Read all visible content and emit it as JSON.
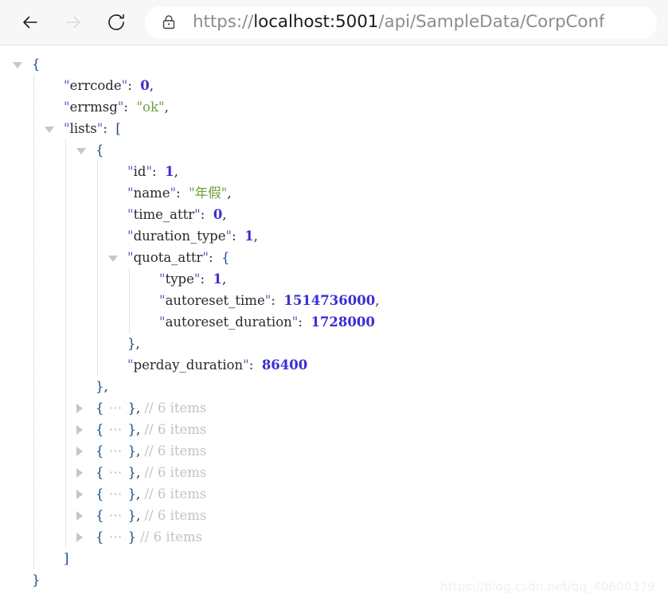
{
  "browser": {
    "back_label": "Back",
    "forward_label": "Forward",
    "reload_label": "Reload",
    "lock_label": "Connection secure",
    "url_full": "https://localhost:5001/api/SampleData/CorpConf",
    "url_scheme": "https://",
    "url_host": "localhost:5001",
    "url_path": "/api/SampleData/CorpConf",
    "forward_disabled": true
  },
  "colors": {
    "toolbar_bg": "#f7f7f7",
    "urlbar_bg": "#ffffff",
    "key": "#26292e",
    "quote": "#7a4ea8",
    "number": "#3b2fd0",
    "string": "#6a9f3f",
    "brace": "#1a4c8b",
    "comment": "#c3c3c3",
    "twisty": "#c6c6c6",
    "guide": "#c9c9c9",
    "watermark": "#f0f0f0"
  },
  "json": {
    "lines": [
      {
        "indent": 0,
        "twisty": "open",
        "tokens": [
          {
            "t": "brace",
            "v": "{"
          }
        ]
      },
      {
        "indent": 1,
        "twisty": null,
        "tokens": [
          {
            "t": "q",
            "v": "\""
          },
          {
            "t": "k",
            "v": "errcode"
          },
          {
            "t": "q",
            "v": "\""
          },
          {
            "t": "punc",
            "v": ":"
          },
          {
            "t": "sp",
            "v": "  "
          },
          {
            "t": "num",
            "v": "0"
          },
          {
            "t": "punc",
            "v": ","
          }
        ]
      },
      {
        "indent": 1,
        "twisty": null,
        "tokens": [
          {
            "t": "q",
            "v": "\""
          },
          {
            "t": "k",
            "v": "errmsg"
          },
          {
            "t": "q",
            "v": "\""
          },
          {
            "t": "punc",
            "v": ":"
          },
          {
            "t": "sp",
            "v": "  "
          },
          {
            "t": "str",
            "v": "\"ok\""
          },
          {
            "t": "punc",
            "v": ","
          }
        ]
      },
      {
        "indent": 1,
        "twisty": "open",
        "tokens": [
          {
            "t": "q",
            "v": "\""
          },
          {
            "t": "k",
            "v": "lists"
          },
          {
            "t": "q",
            "v": "\""
          },
          {
            "t": "punc",
            "v": ":"
          },
          {
            "t": "sp",
            "v": "  "
          },
          {
            "t": "brace",
            "v": "["
          }
        ]
      },
      {
        "indent": 2,
        "twisty": "open",
        "tokens": [
          {
            "t": "brace",
            "v": "{"
          }
        ]
      },
      {
        "indent": 3,
        "twisty": null,
        "tokens": [
          {
            "t": "q",
            "v": "\""
          },
          {
            "t": "k",
            "v": "id"
          },
          {
            "t": "q",
            "v": "\""
          },
          {
            "t": "punc",
            "v": ":"
          },
          {
            "t": "sp",
            "v": "  "
          },
          {
            "t": "num",
            "v": "1"
          },
          {
            "t": "punc",
            "v": ","
          }
        ]
      },
      {
        "indent": 3,
        "twisty": null,
        "tokens": [
          {
            "t": "q",
            "v": "\""
          },
          {
            "t": "k",
            "v": "name"
          },
          {
            "t": "q",
            "v": "\""
          },
          {
            "t": "punc",
            "v": ":"
          },
          {
            "t": "sp",
            "v": "  "
          },
          {
            "t": "str",
            "v": "\"年假\""
          },
          {
            "t": "punc",
            "v": ","
          }
        ]
      },
      {
        "indent": 3,
        "twisty": null,
        "tokens": [
          {
            "t": "q",
            "v": "\""
          },
          {
            "t": "k",
            "v": "time_attr"
          },
          {
            "t": "q",
            "v": "\""
          },
          {
            "t": "punc",
            "v": ":"
          },
          {
            "t": "sp",
            "v": "  "
          },
          {
            "t": "num",
            "v": "0"
          },
          {
            "t": "punc",
            "v": ","
          }
        ]
      },
      {
        "indent": 3,
        "twisty": null,
        "tokens": [
          {
            "t": "q",
            "v": "\""
          },
          {
            "t": "k",
            "v": "duration_type"
          },
          {
            "t": "q",
            "v": "\""
          },
          {
            "t": "punc",
            "v": ":"
          },
          {
            "t": "sp",
            "v": "  "
          },
          {
            "t": "num",
            "v": "1"
          },
          {
            "t": "punc",
            "v": ","
          }
        ]
      },
      {
        "indent": 3,
        "twisty": "open",
        "tokens": [
          {
            "t": "q",
            "v": "\""
          },
          {
            "t": "k",
            "v": "quota_attr"
          },
          {
            "t": "q",
            "v": "\""
          },
          {
            "t": "punc",
            "v": ":"
          },
          {
            "t": "sp",
            "v": "  "
          },
          {
            "t": "brace",
            "v": "{"
          }
        ]
      },
      {
        "indent": 4,
        "twisty": null,
        "tokens": [
          {
            "t": "q",
            "v": "\""
          },
          {
            "t": "k",
            "v": "type"
          },
          {
            "t": "q",
            "v": "\""
          },
          {
            "t": "punc",
            "v": ":"
          },
          {
            "t": "sp",
            "v": "  "
          },
          {
            "t": "num",
            "v": "1"
          },
          {
            "t": "punc",
            "v": ","
          }
        ]
      },
      {
        "indent": 4,
        "twisty": null,
        "tokens": [
          {
            "t": "q",
            "v": "\""
          },
          {
            "t": "k",
            "v": "autoreset_time"
          },
          {
            "t": "q",
            "v": "\""
          },
          {
            "t": "punc",
            "v": ":"
          },
          {
            "t": "sp",
            "v": "  "
          },
          {
            "t": "num",
            "v": "1514736000"
          },
          {
            "t": "punc",
            "v": ","
          }
        ]
      },
      {
        "indent": 4,
        "twisty": null,
        "tokens": [
          {
            "t": "q",
            "v": "\""
          },
          {
            "t": "k",
            "v": "autoreset_duration"
          },
          {
            "t": "q",
            "v": "\""
          },
          {
            "t": "punc",
            "v": ":"
          },
          {
            "t": "sp",
            "v": "  "
          },
          {
            "t": "num",
            "v": "1728000"
          }
        ]
      },
      {
        "indent": 3,
        "twisty": null,
        "tokens": [
          {
            "t": "brace",
            "v": "}"
          },
          {
            "t": "punc",
            "v": ","
          }
        ]
      },
      {
        "indent": 3,
        "twisty": null,
        "tokens": [
          {
            "t": "q",
            "v": "\""
          },
          {
            "t": "k",
            "v": "perday_duration"
          },
          {
            "t": "q",
            "v": "\""
          },
          {
            "t": "punc",
            "v": ":"
          },
          {
            "t": "sp",
            "v": "  "
          },
          {
            "t": "num",
            "v": "86400"
          }
        ]
      },
      {
        "indent": 2,
        "twisty": null,
        "tokens": [
          {
            "t": "brace",
            "v": "}"
          },
          {
            "t": "punc",
            "v": ","
          }
        ]
      },
      {
        "indent": 2,
        "twisty": "closed",
        "tokens": [
          {
            "t": "brace",
            "v": "{"
          },
          {
            "t": "ell",
            "v": " ⋯ "
          },
          {
            "t": "brace",
            "v": "}"
          },
          {
            "t": "punc",
            "v": ","
          },
          {
            "t": "sp",
            "v": " "
          },
          {
            "t": "cmt",
            "v": "// 6 items"
          }
        ]
      },
      {
        "indent": 2,
        "twisty": "closed",
        "tokens": [
          {
            "t": "brace",
            "v": "{"
          },
          {
            "t": "ell",
            "v": " ⋯ "
          },
          {
            "t": "brace",
            "v": "}"
          },
          {
            "t": "punc",
            "v": ","
          },
          {
            "t": "sp",
            "v": " "
          },
          {
            "t": "cmt",
            "v": "// 6 items"
          }
        ]
      },
      {
        "indent": 2,
        "twisty": "closed",
        "tokens": [
          {
            "t": "brace",
            "v": "{"
          },
          {
            "t": "ell",
            "v": " ⋯ "
          },
          {
            "t": "brace",
            "v": "}"
          },
          {
            "t": "punc",
            "v": ","
          },
          {
            "t": "sp",
            "v": " "
          },
          {
            "t": "cmt",
            "v": "// 6 items"
          }
        ]
      },
      {
        "indent": 2,
        "twisty": "closed",
        "tokens": [
          {
            "t": "brace",
            "v": "{"
          },
          {
            "t": "ell",
            "v": " ⋯ "
          },
          {
            "t": "brace",
            "v": "}"
          },
          {
            "t": "punc",
            "v": ","
          },
          {
            "t": "sp",
            "v": " "
          },
          {
            "t": "cmt",
            "v": "// 6 items"
          }
        ]
      },
      {
        "indent": 2,
        "twisty": "closed",
        "tokens": [
          {
            "t": "brace",
            "v": "{"
          },
          {
            "t": "ell",
            "v": " ⋯ "
          },
          {
            "t": "brace",
            "v": "}"
          },
          {
            "t": "punc",
            "v": ","
          },
          {
            "t": "sp",
            "v": " "
          },
          {
            "t": "cmt",
            "v": "// 6 items"
          }
        ]
      },
      {
        "indent": 2,
        "twisty": "closed",
        "tokens": [
          {
            "t": "brace",
            "v": "{"
          },
          {
            "t": "ell",
            "v": " ⋯ "
          },
          {
            "t": "brace",
            "v": "}"
          },
          {
            "t": "punc",
            "v": ","
          },
          {
            "t": "sp",
            "v": " "
          },
          {
            "t": "cmt",
            "v": "// 6 items"
          }
        ]
      },
      {
        "indent": 2,
        "twisty": "closed",
        "tokens": [
          {
            "t": "brace",
            "v": "{"
          },
          {
            "t": "ell",
            "v": " ⋯ "
          },
          {
            "t": "brace",
            "v": "}"
          },
          {
            "t": "sp",
            "v": " "
          },
          {
            "t": "cmt",
            "v": "// 6 items"
          }
        ]
      },
      {
        "indent": 1,
        "twisty": null,
        "tokens": [
          {
            "t": "brace",
            "v": "]"
          }
        ]
      },
      {
        "indent": 0,
        "twisty": null,
        "tokens": [
          {
            "t": "brace",
            "v": "}"
          }
        ]
      }
    ]
  },
  "watermark": "https://blog.csdn.net/qq_40600379"
}
